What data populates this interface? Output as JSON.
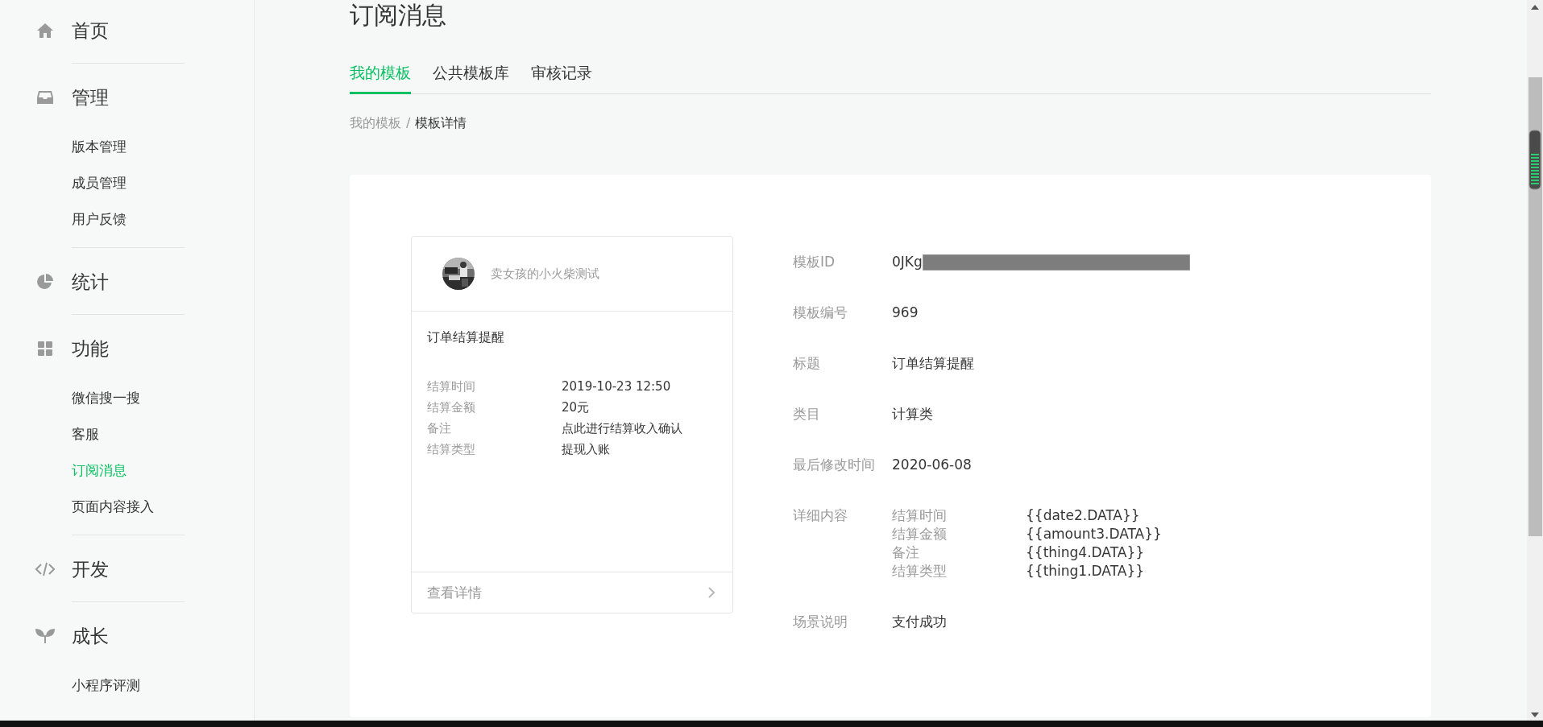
{
  "sidebar": {
    "sections": [
      {
        "title": "首页"
      },
      {
        "title": "管理",
        "items": [
          {
            "label": "版本管理",
            "selected": false
          },
          {
            "label": "成员管理",
            "selected": false
          },
          {
            "label": "用户反馈",
            "selected": false
          }
        ]
      },
      {
        "title": "统计"
      },
      {
        "title": "功能",
        "items": [
          {
            "label": "微信搜一搜",
            "selected": false
          },
          {
            "label": "客服",
            "selected": false
          },
          {
            "label": "订阅消息",
            "selected": true
          },
          {
            "label": "页面内容接入",
            "selected": false
          }
        ]
      },
      {
        "title": "开发"
      },
      {
        "title": "成长",
        "items": [
          {
            "label": "小程序评测",
            "selected": false
          }
        ]
      }
    ]
  },
  "page": {
    "title": "订阅消息",
    "tabs": [
      {
        "label": "我的模板",
        "selected": true
      },
      {
        "label": "公共模板库",
        "selected": false
      },
      {
        "label": "审核记录",
        "selected": false
      }
    ],
    "breadcrumb": [
      "我的模板",
      "/",
      "模板详情"
    ]
  },
  "preview": {
    "account": "卖女孩的小火柴测试",
    "title": "订单结算提醒",
    "fields": [
      {
        "label": "结算时间",
        "value": "2019-10-23 12:50"
      },
      {
        "label": "结算金额",
        "value": "20元"
      },
      {
        "label": "备注",
        "value": "点此进行结算收入确认"
      },
      {
        "label": "结算类型",
        "value": "提现入账"
      }
    ],
    "link": "查看详情"
  },
  "details": [
    {
      "kind": "redacted",
      "label": "模板ID",
      "value": "0JKg"
    },
    {
      "kind": "text",
      "label": "模板编号",
      "value": "969"
    },
    {
      "kind": "text",
      "label": "标题",
      "value": "订单结算提醒"
    },
    {
      "kind": "text",
      "label": "类目",
      "value": "计算类"
    },
    {
      "kind": "text",
      "label": "最后修改时间",
      "value": "2020-06-08"
    },
    {
      "kind": "fields",
      "label": "详细内容",
      "fields": [
        {
          "label": "结算时间",
          "value": "{{date2.DATA}}"
        },
        {
          "label": "结算金额",
          "value": "{{amount3.DATA}}"
        },
        {
          "label": "备注",
          "value": "{{thing4.DATA}}"
        },
        {
          "label": "结算类型",
          "value": "{{thing1.DATA}}"
        }
      ]
    },
    {
      "kind": "text",
      "label": "场景说明",
      "value": "支付成功"
    }
  ]
}
